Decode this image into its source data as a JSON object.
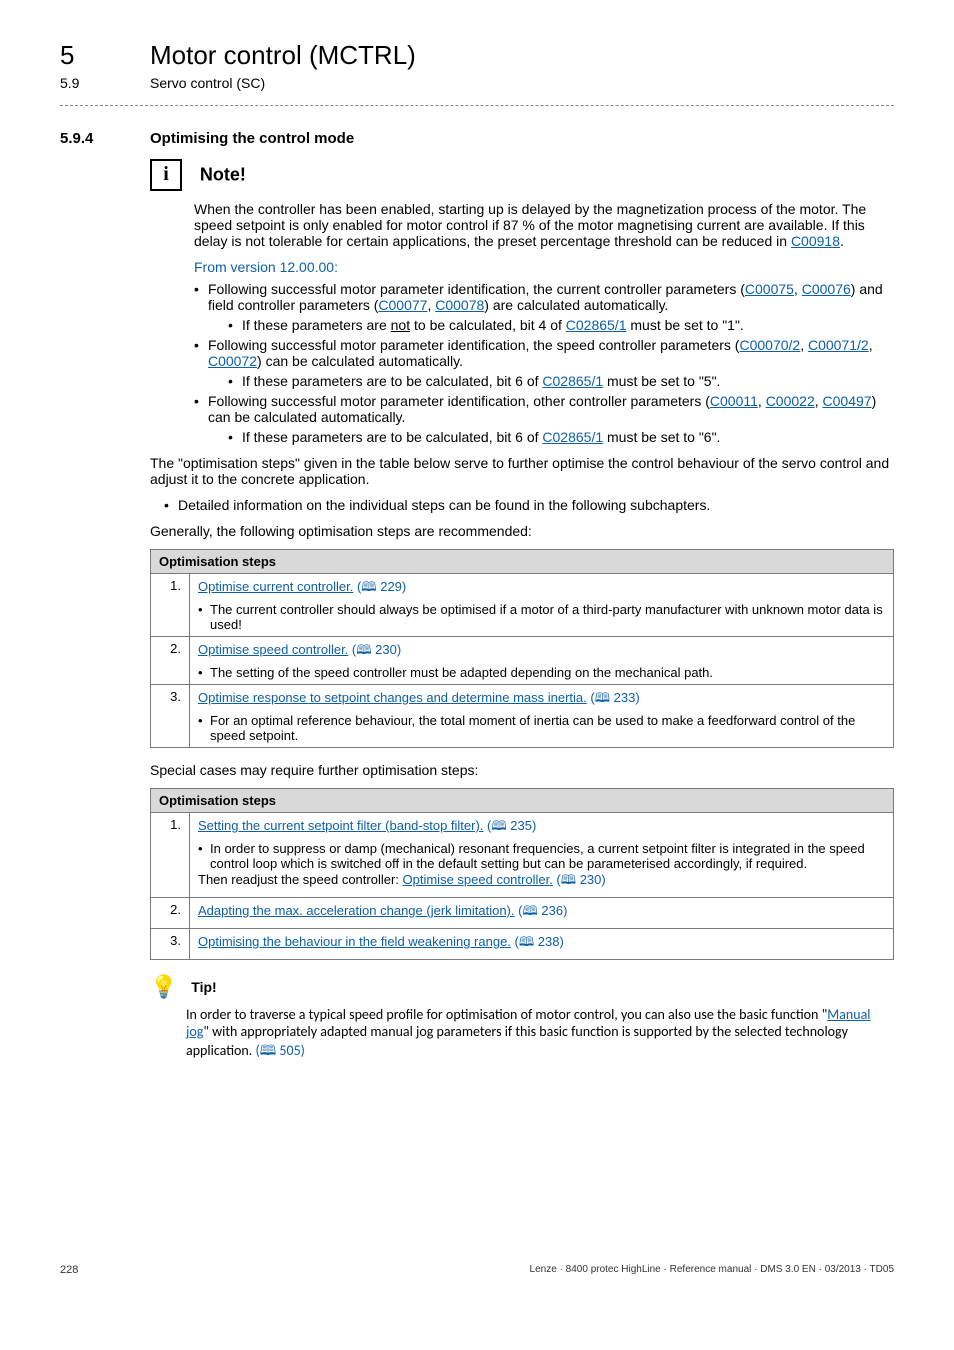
{
  "header": {
    "chapter_num": "5",
    "chapter_title": "Motor control (MCTRL)",
    "sub_num": "5.9",
    "sub_title": "Servo control (SC)"
  },
  "section": {
    "num": "5.9.4",
    "title": "Optimising the control mode"
  },
  "note": {
    "heading": "Note!",
    "para": "When the controller has been enabled, starting up is delayed by the magnetization process of the motor. The speed setpoint is only enabled for motor control if 87 % of the motor magnetising current are available. If this delay is not tolerable for certain applications, the preset percentage threshold can be reduced in ",
    "para_link": "C00918",
    "para_end": ".",
    "version": "From version 12.00.00:",
    "b1_a": "Following successful motor parameter identification, the current controller parameters (",
    "b1_l1": "C00075",
    "b1_m1": ", ",
    "b1_l2": "C00076",
    "b1_m2": ") and field controller parameters (",
    "b1_l3": "C00077",
    "b1_m3": ", ",
    "b1_l4": "C00078",
    "b1_b": ") are calculated automatically.",
    "b1s_a": "If these parameters are ",
    "b1s_not": "not",
    "b1s_b": " to be calculated, bit 4 of ",
    "b1s_l": "C02865/1",
    "b1s_c": " must be set to \"1\".",
    "b2_a": "Following successful motor parameter identification, the speed controller parameters (",
    "b2_l1": "C00070/2",
    "b2_m1": ", ",
    "b2_l2": "C00071/2",
    "b2_m2": ", ",
    "b2_l3": "C00072",
    "b2_b": ") can be calculated automatically.",
    "b2s_a": "If these parameters are to be calculated, bit 6 of ",
    "b2s_l": "C02865/1",
    "b2s_b": " must be set to \"5\".",
    "b3_a": "Following successful motor parameter identification, other controller parameters (",
    "b3_l1": "C00011",
    "b3_m1": ", ",
    "b3_l2": "C00022",
    "b3_m2": ", ",
    "b3_l3": "C00497",
    "b3_b": ") can be calculated automatically.",
    "b3s_a": "If these parameters are to be calculated, bit 6 of ",
    "b3s_l": "C02865/1",
    "b3s_b": " must be set to \"6\"."
  },
  "body": {
    "p1": "The \"optimisation steps\" given in the table below serve to further optimise the control behaviour of the servo control and adjust it to the concrete application.",
    "p1_bullet": "Detailed information on the individual steps can be found in the following subchapters.",
    "p2": "Generally, the following optimisation steps are recommended:",
    "p3": "Special cases may require further optimisation steps:"
  },
  "table1": {
    "header": "Optimisation steps",
    "rows": [
      {
        "n": "1.",
        "link": "Optimise current controller.",
        "ref": " (🕮 229)",
        "sub": "The current controller should always be optimised if a motor of a third-party manufacturer with unknown motor data is used!"
      },
      {
        "n": "2.",
        "link": "Optimise speed controller.",
        "ref": " (🕮 230)",
        "sub": "The setting of the speed controller must be adapted depending on the mechanical path."
      },
      {
        "n": "3.",
        "link": "Optimise response to setpoint changes and determine mass inertia.",
        "ref": " (🕮 233)",
        "sub": "For an optimal reference behaviour, the total moment of inertia can be used to make a feedforward control of the speed setpoint."
      }
    ]
  },
  "table2": {
    "header": "Optimisation steps",
    "rows": [
      {
        "n": "1.",
        "link": "Setting the current setpoint filter (band-stop filter).",
        "ref": " (🕮 235)",
        "sub": "In order to suppress or damp (mechanical) resonant frequencies, a current setpoint filter is integrated in the speed control loop which is switched off in the default setting but can be parameterised accordingly, if required.",
        "after_a": "Then readjust the speed controller: ",
        "after_link": "Optimise speed controller.",
        "after_ref": " (🕮 230)"
      },
      {
        "n": "2.",
        "link": "Adapting the max. acceleration change (jerk limitation).",
        "ref": " (🕮 236)"
      },
      {
        "n": "3.",
        "link": "Optimising the behaviour in the field weakening range.",
        "ref": " (🕮 238)"
      }
    ]
  },
  "tip": {
    "heading": "Tip!",
    "body_a": "In order to traverse a typical speed profile for optimisation of motor control, you can also use the basic function \"",
    "body_link": "Manual jog",
    "body_b": "\" with appropriately adapted manual jog parameters if this basic function is supported by the selected technology application. ",
    "body_ref": "(🕮 505)"
  },
  "footer": {
    "page": "228",
    "book": "Lenze · 8400 protec HighLine · Reference manual · DMS 3.0 EN · 03/2013 · TD05"
  }
}
